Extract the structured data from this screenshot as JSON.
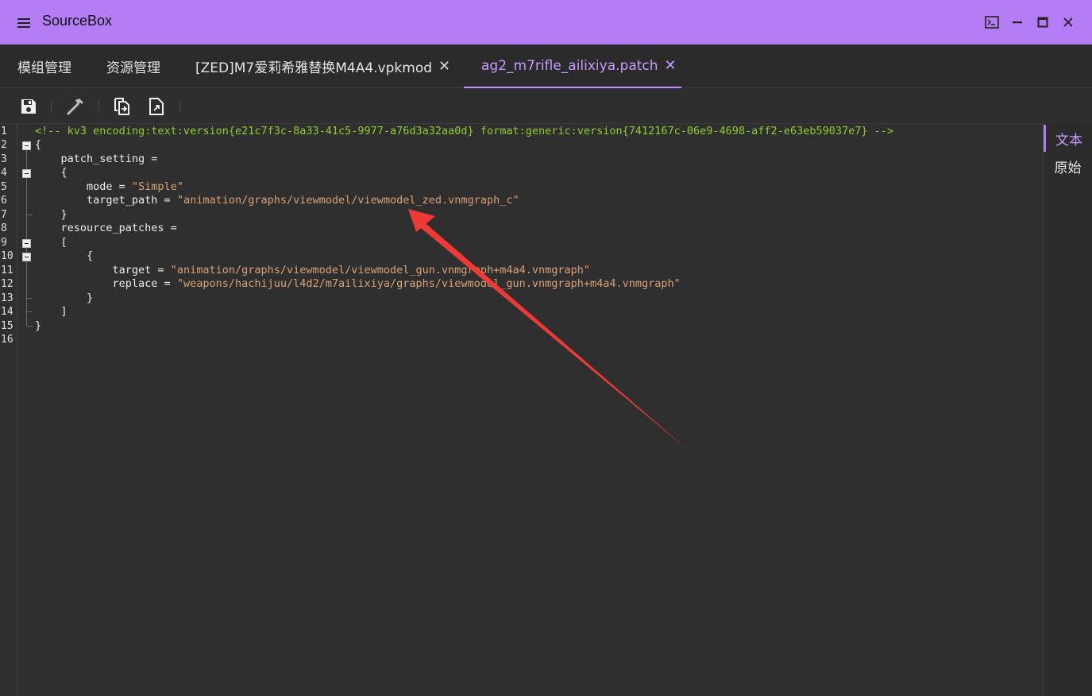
{
  "window": {
    "title": "SourceBox"
  },
  "tabs": [
    {
      "label": "模组管理",
      "closable": false,
      "active": false
    },
    {
      "label": "资源管理",
      "closable": false,
      "active": false
    },
    {
      "label": "[ZED]M7爱莉希雅替换M4A4.vpkmod",
      "closable": true,
      "active": false
    },
    {
      "label": "ag2_m7rifle_ailixiya.patch",
      "closable": true,
      "active": true
    }
  ],
  "tab_close_glyph": "✕",
  "toolbar": {
    "icons": [
      "save-icon",
      "hammer-icon",
      "copy-export-icon",
      "file-export-icon"
    ]
  },
  "editor": {
    "line_numbers": [
      "1",
      "2",
      "3",
      "4",
      "5",
      "6",
      "7",
      "8",
      "9",
      "10",
      "11",
      "12",
      "13",
      "14",
      "15",
      "16"
    ],
    "lines": {
      "l1": "<!-- kv3 encoding:text:version{e21c7f3c-8a33-41c5-9977-a76d3a32aa0d} format:generic:version{7412167c-06e9-4698-aff2-e63eb59037e7} -->",
      "l2": "{",
      "l3": "    patch_setting =",
      "l4": "    {",
      "l5_key": "        mode = ",
      "l5_val": "\"Simple\"",
      "l6_key": "        target_path = ",
      "l6_val": "\"animation/graphs/viewmodel/viewmodel_zed.vnmgraph_c\"",
      "l7": "    }",
      "l8": "    resource_patches =",
      "l9": "    [",
      "l10": "        {",
      "l11_key": "            target = ",
      "l11_val": "\"animation/graphs/viewmodel/viewmodel_gun.vnmgraph+m4a4.vnmgraph\"",
      "l12_key": "            replace = ",
      "l12_val": "\"weapons/hachijuu/l4d2/m7ailixiya/graphs/viewmodel_gun.vnmgraph+m4a4.vnmgraph\"",
      "l13": "        }",
      "l14": "    ]",
      "l15": "}"
    }
  },
  "side_panel": {
    "items": [
      {
        "label": "文本",
        "active": true
      },
      {
        "label": "原始",
        "active": false
      }
    ]
  },
  "colors": {
    "titlebar": "#b47cf5",
    "accent": "#c89bff",
    "comment": "#8fcf2c",
    "string": "#d9a277",
    "arrow": "#ee3a35"
  }
}
